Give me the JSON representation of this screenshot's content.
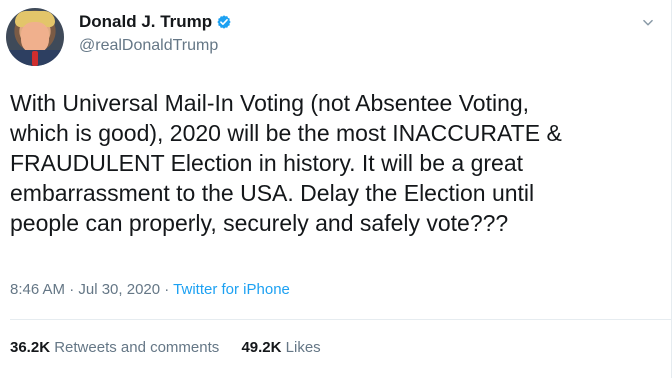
{
  "user": {
    "display_name": "Donald J. Trump",
    "handle": "@realDonaldTrump",
    "verified": true
  },
  "tweet": {
    "text": "With Universal Mail-In Voting (not Absentee Voting,\nwhich is good), 2020 will be the most INACCURATE &\nFRAUDULENT Election in history. It will be a great\nembarrassment to the USA. Delay the Election until\npeople can properly, securely and safely vote???"
  },
  "meta": {
    "timestamp": "8:46 AM · Jul 30, 2020",
    "separator": " · ",
    "source": "Twitter for iPhone"
  },
  "stats": {
    "retweets_count": "36.2K",
    "retweets_label": "Retweets and comments",
    "likes_count": "49.2K",
    "likes_label": "Likes"
  },
  "colors": {
    "text": "#14171a",
    "secondary": "#657786",
    "link": "#1da1f2",
    "border": "#e6ecf0"
  },
  "icons": {
    "verified": "verified-badge-icon",
    "menu": "chevron-down-icon"
  }
}
